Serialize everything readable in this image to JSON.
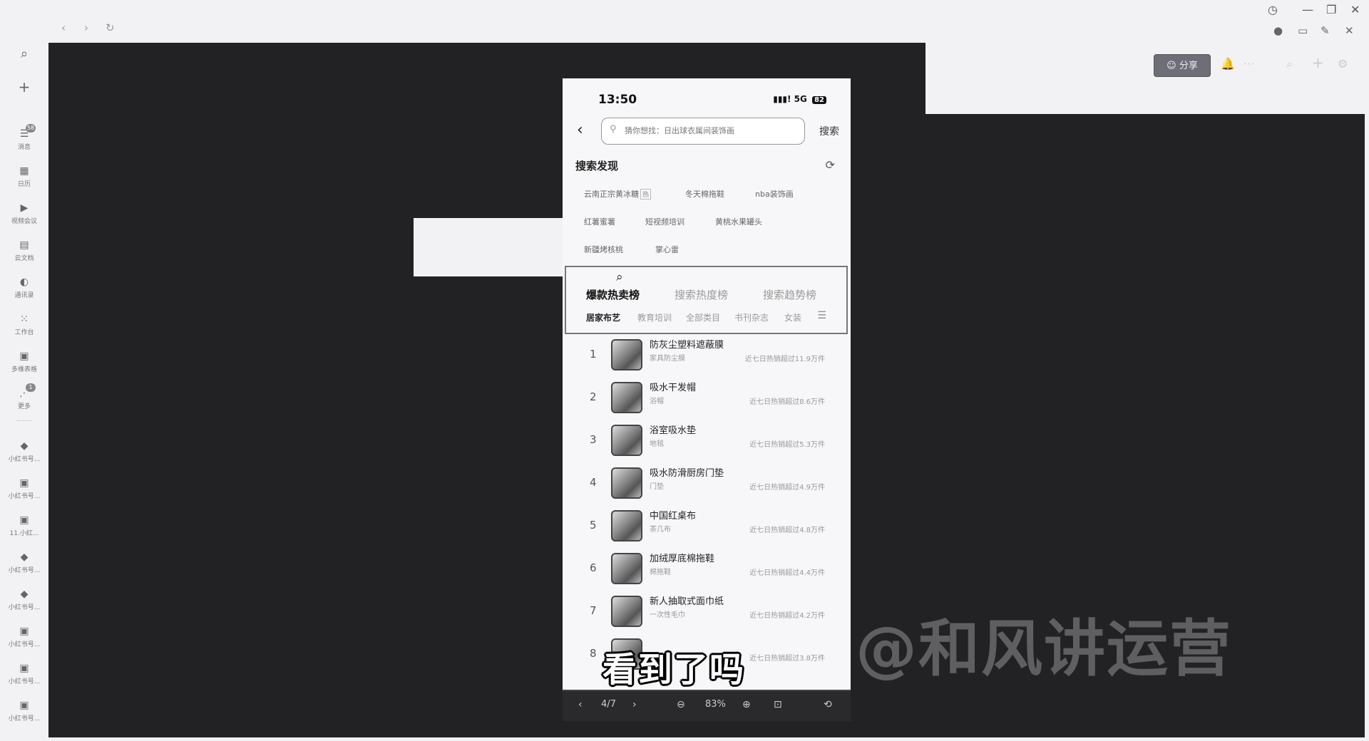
{
  "app": {
    "nav_back": "‹",
    "nav_forward": "›",
    "nav_reload": "↻",
    "win_history": "◷",
    "win_minimize": "—",
    "win_restore": "❐",
    "win_close": "✕",
    "sys_chat": "●",
    "sys_monitor": "▭",
    "sys_pin": "✎",
    "sys_close": "✕"
  },
  "sidebar": {
    "search_icon": "⌕",
    "add_icon": "+",
    "items": [
      {
        "icon": "☰",
        "label": "消息",
        "badge": "58"
      },
      {
        "icon": "▦",
        "label": "日历",
        "badge": ""
      },
      {
        "icon": "▶",
        "label": "视频会议",
        "badge": ""
      },
      {
        "icon": "▤",
        "label": "云文档",
        "badge": ""
      },
      {
        "icon": "◐",
        "label": "通讯录",
        "badge": ""
      },
      {
        "icon": "⁙",
        "label": "工作台",
        "badge": ""
      },
      {
        "icon": "▣",
        "label": "多维表格",
        "badge": ""
      },
      {
        "icon": "⋰",
        "label": "更多",
        "badge": "1"
      }
    ],
    "groups": [
      {
        "icon": "◆",
        "label": "小红书号..."
      },
      {
        "icon": "▣",
        "label": "小红书号..."
      },
      {
        "icon": "▣",
        "label": "11.小红..."
      },
      {
        "icon": "◆",
        "label": "小红书号..."
      },
      {
        "icon": "◆",
        "label": "小红书号..."
      },
      {
        "icon": "▣",
        "label": "小红书号..."
      },
      {
        "icon": "▣",
        "label": "小红书号..."
      },
      {
        "icon": "▣",
        "label": "小红书号..."
      }
    ]
  },
  "toolbar": {
    "share_label": "分享",
    "bell": "🔔",
    "more": "···",
    "search": "⌕",
    "add": "+",
    "settings": "⚙"
  },
  "phone": {
    "time": "13:50",
    "signal": "▮▮▮! 5G",
    "battery": "82",
    "back": "‹",
    "search_placeholder": "猜你想找：日出球衣属间装饰画",
    "search_button": "搜索",
    "discover_title": "搜索发现",
    "refresh": "⟳",
    "tags": [
      {
        "text": "云南正宗黄冰糖",
        "mark": "热"
      },
      {
        "text": "冬天棉拖鞋",
        "mark": ""
      },
      {
        "text": "nba装饰画",
        "mark": ""
      },
      {
        "text": "红薯蜜薯",
        "mark": ""
      },
      {
        "text": "短视频培训",
        "mark": ""
      },
      {
        "text": "黄桃水果罐头",
        "mark": ""
      },
      {
        "text": "新疆烤核桃",
        "mark": ""
      },
      {
        "text": "掌心雷",
        "mark": ""
      }
    ],
    "rank_icon": "⌕",
    "rank_tabs": [
      "爆款热卖榜",
      "搜索热度榜",
      "搜索趋势榜"
    ],
    "categories": [
      "居家布艺",
      "教育培训",
      "全部类目",
      "书刊杂志",
      "女装"
    ],
    "category_menu": "☰",
    "items": [
      {
        "rank": "1",
        "name": "防灰尘塑料遮蔽膜",
        "sub": "家具防尘膜",
        "sales": "近七日热销超过11.9万件"
      },
      {
        "rank": "2",
        "name": "吸水干发帽",
        "sub": "浴帽",
        "sales": "近七日热销超过8.6万件"
      },
      {
        "rank": "3",
        "name": "浴室吸水垫",
        "sub": "地毯",
        "sales": "近七日热销超过5.3万件"
      },
      {
        "rank": "4",
        "name": "吸水防滑厨房门垫",
        "sub": "门垫",
        "sales": "近七日热销超过4.9万件"
      },
      {
        "rank": "5",
        "name": "中国红桌布",
        "sub": "茶几布",
        "sales": "近七日热销超过4.8万件"
      },
      {
        "rank": "6",
        "name": "加绒厚底棉拖鞋",
        "sub": "棉拖鞋",
        "sales": "近七日热销超过4.4万件"
      },
      {
        "rank": "7",
        "name": "新人抽取式面巾纸",
        "sub": "一次性毛巾",
        "sales": "近七日热销超过4.2万件"
      },
      {
        "rank": "8",
        "name": "",
        "sub": "",
        "sales": "近七日热销超过3.8万件"
      }
    ]
  },
  "overlay": {
    "subtitle": "看到了吗",
    "watermark": "@和风讲运营"
  },
  "viewer": {
    "prev": "‹",
    "page": "4/7",
    "next": "›",
    "zoom_out": "⊖",
    "zoom": "83%",
    "zoom_in": "⊕",
    "actual_size": "⊡",
    "rotate": "⟲"
  }
}
